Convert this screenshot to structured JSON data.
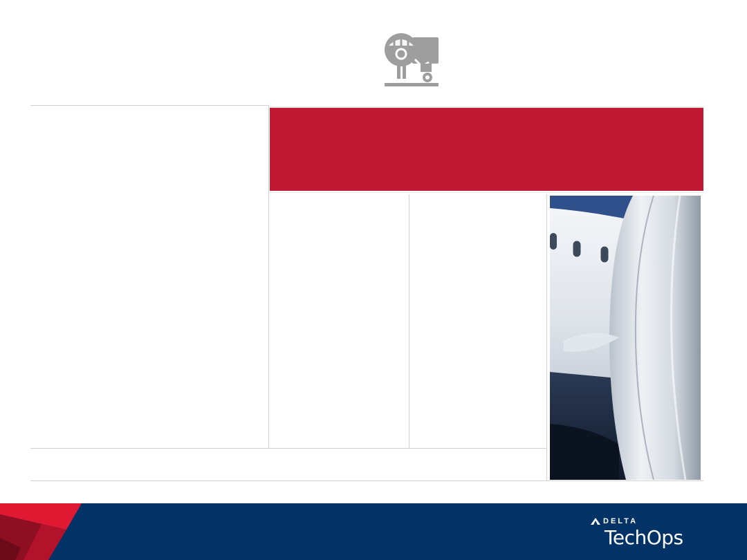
{
  "header": {
    "icon": "aircraft-nose-stand-icon"
  },
  "banner": {
    "color": "#c01933"
  },
  "photo": {
    "subject": "aircraft-engine-nacelle-photo"
  },
  "footer": {
    "background": "#033366",
    "brand_top": "DELTA",
    "brand_main": "TechOps"
  }
}
